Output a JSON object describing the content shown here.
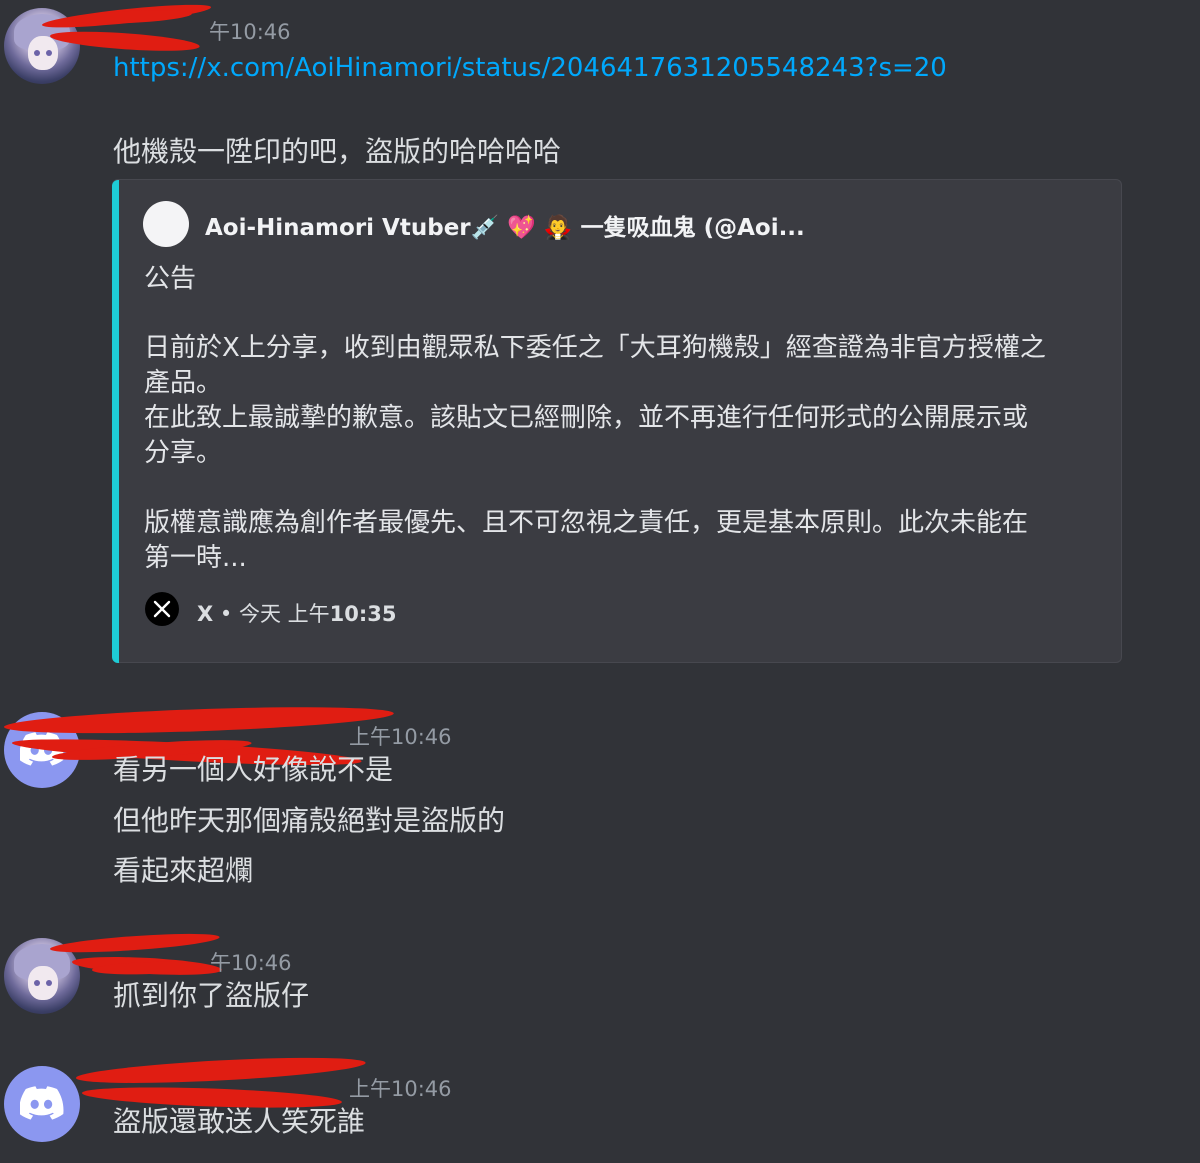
{
  "messages": [
    {
      "author_redacted": true,
      "avatar": "anime-girl-avatar",
      "time": "上午10:46",
      "time_visible": "午10:46",
      "link": "https://x.com/AoiHinamori/status/2046417631205548243?s=20",
      "text": "他機殼一陞印的吧，盜版的哈哈哈哈"
    },
    {
      "author_redacted": true,
      "avatar": "discord-default-avatar",
      "time_visible": "上午10:46",
      "lines": [
        "看另一個人好像說不是",
        "但他昨天那個痛殼絕對是盜版的",
        "看起來超爛"
      ]
    },
    {
      "author_redacted": true,
      "avatar": "anime-girl-avatar",
      "time_visible": "午10:46",
      "text": "抓到你了盜版仔"
    },
    {
      "author_redacted": true,
      "avatar": "discord-default-avatar",
      "time_visible": "上午10:46",
      "text": "盜版還敢送人笑死誰"
    }
  ],
  "embed": {
    "accent_color": "#1eccd6",
    "author": "Aoi-Hinamori Vtuber💉 💖 🧛 一隻吸血鬼 (@Aoi...",
    "lines": [
      "公告",
      "日前於X上分享，收到由觀眾私下委任之「大耳狗機殼」經查證為非官方授權之",
      "產品。",
      "在此致上最誠摯的歉意。該貼文已經刪除，並不再進行任何形式的公開展示或",
      "分享。",
      "版權意識應為創作者最優先、且不可忽視之責任，更是基本原則。此次未能在",
      "第一時..."
    ],
    "footer_source": "X",
    "footer_sep": " • ",
    "footer_date": "今天 上午",
    "footer_time": "10:35"
  },
  "colors": {
    "background": "#313338",
    "text": "#dbdee1",
    "link": "#00a8fc",
    "timestamp": "#949ba4",
    "redaction": "#e01d12"
  }
}
